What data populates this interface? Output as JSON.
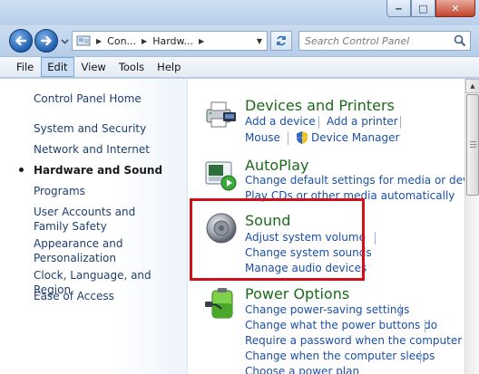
{
  "window": {
    "minimize_label": "‒",
    "maximize_label": "□",
    "close_label": "✕"
  },
  "address": {
    "crumbs": [
      "Con...",
      "Hardw..."
    ],
    "search_placeholder": "Search Control Panel"
  },
  "menu": [
    "File",
    "Edit",
    "View",
    "Tools",
    "Help"
  ],
  "menu_active": "Edit",
  "sidebar": {
    "home": "Control Panel Home",
    "items": [
      "System and Security",
      "Network and Internet",
      "Hardware and Sound",
      "Programs",
      "User Accounts and Family Safety",
      "Appearance and Personalization",
      "Clock, Language, and Region",
      "Ease of Access"
    ],
    "current": "Hardware and Sound"
  },
  "categories": {
    "devices": {
      "title": "Devices and Printers",
      "links": [
        "Add a device",
        "Add a printer",
        "Mouse",
        "Device Manager"
      ]
    },
    "autoplay": {
      "title": "AutoPlay",
      "links": [
        "Change default settings for media or devi",
        "Play CDs or other media automatically"
      ]
    },
    "sound": {
      "title": "Sound",
      "links": [
        "Adjust system volume",
        "Change system sounds",
        "Manage audio devices"
      ]
    },
    "power": {
      "title": "Power Options",
      "links": [
        "Change power-saving settings",
        "Change what the power buttons do",
        "Require a password when the computer w",
        "Change when the computer sleeps",
        "Choose a power plan"
      ]
    }
  },
  "colors": {
    "category_title": "#1a6b1a",
    "link": "#1b4fa8",
    "highlight": "#d0101a"
  }
}
